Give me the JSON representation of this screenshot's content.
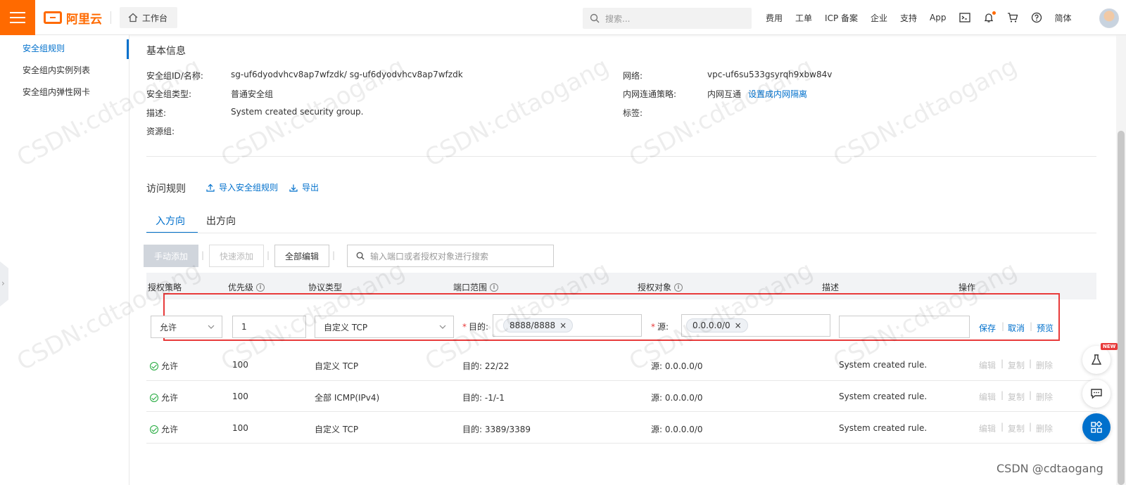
{
  "header": {
    "logo_text": "阿里云",
    "workbench": "工作台",
    "search_placeholder": "搜索...",
    "links": [
      "费用",
      "工单",
      "ICP 备案",
      "企业",
      "支持",
      "App"
    ],
    "lang": "简体"
  },
  "sidebar": {
    "items": [
      {
        "label": "安全组规则",
        "active": true
      },
      {
        "label": "安全组内实例列表",
        "active": false
      },
      {
        "label": "安全组内弹性网卡",
        "active": false
      }
    ]
  },
  "basic_info": {
    "title": "基本信息",
    "sg_id_label": "安全组ID/名称:",
    "sg_id_value": "sg-uf6dyodvhcv8ap7wfzdk/ sg-uf6dyodvhcv8ap7wfzdk",
    "sg_type_label": "安全组类型:",
    "sg_type_value": "普通安全组",
    "desc_label": "描述:",
    "desc_value": "System created security group.",
    "rg_label": "资源组:",
    "network_label": "网络:",
    "network_value": "vpc-uf6su533gsyrqh9xbw84v",
    "policy_label": "内网连通策略:",
    "policy_value": "内网互通",
    "policy_link": "设置成内网隔离",
    "tags_label": "标签:"
  },
  "rules": {
    "title": "访问规则",
    "import_link": "导入安全组规则",
    "export_link": "导出",
    "tabs": [
      "入方向",
      "出方向"
    ],
    "buttons": {
      "manual_add": "手动添加",
      "quick_add": "快速添加",
      "edit_all": "全部编辑"
    },
    "search_placeholder": "输入端口或者授权对象进行搜索",
    "columns": [
      "授权策略",
      "优先级",
      "协议类型",
      "端口范围",
      "授权对象",
      "描述",
      "操作"
    ],
    "edit_row": {
      "policy": "允许",
      "priority": "1",
      "protocol": "自定义 TCP",
      "dest_label": "目的:",
      "dest_chip": "8888/8888",
      "src_label": "源:",
      "src_chip": "0.0.0.0/0",
      "description": "",
      "ops": [
        "保存",
        "取消",
        "预览"
      ]
    },
    "rows": [
      {
        "policy": "允许",
        "priority": "100",
        "protocol": "自定义 TCP",
        "port": "目的: 22/22",
        "source": "源: 0.0.0.0/0",
        "desc": "System created rule."
      },
      {
        "policy": "允许",
        "priority": "100",
        "protocol": "全部 ICMP(IPv4)",
        "port": "目的: -1/-1",
        "source": "源: 0.0.0.0/0",
        "desc": "System created rule."
      },
      {
        "policy": "允许",
        "priority": "100",
        "protocol": "自定义 TCP",
        "port": "目的: 3389/3389",
        "source": "源: 0.0.0.0/0",
        "desc": "System created rule."
      }
    ],
    "row_ops": [
      "编辑",
      "复制",
      "删除"
    ]
  },
  "floating": {
    "new_badge": "NEW"
  },
  "watermark": "CSDN:cdtaogang",
  "signature": "CSDN @cdtaogang"
}
